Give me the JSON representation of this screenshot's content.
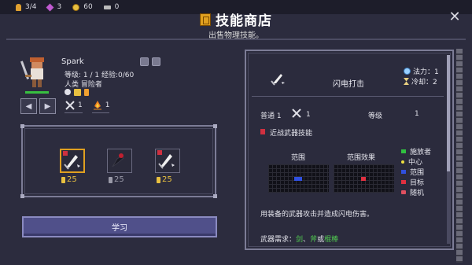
{
  "topbar": {
    "hp": "3/4",
    "gems": "3",
    "gold": "60",
    "keys": "0"
  },
  "header": {
    "title": "技能商店",
    "subtitle": "出售物理技能。",
    "close_icon": "close-icon"
  },
  "character": {
    "name": "Spark",
    "level_text": "等级: 1 / 1   经验:0/60",
    "class_text": "人类 冒险者",
    "hp_fraction": 1.0
  },
  "skill_points": [
    {
      "icon": "crossed-swords-icon",
      "value": "1"
    },
    {
      "icon": "campfire-icon",
      "value": "1"
    }
  ],
  "shop_skills": [
    {
      "icon": "lightning-strike-icon",
      "cost": "25",
      "selected": true
    },
    {
      "icon": "dark-slash-icon",
      "cost": "25",
      "selected": false
    },
    {
      "icon": "lightning-strike-icon",
      "cost": "25",
      "selected": false
    }
  ],
  "learn_button": "学习",
  "detail": {
    "skill_name": "闪电打击",
    "mana": "法力：1",
    "cooldown": "冷却：2",
    "normal_label": "普通 1",
    "normal_value": "1",
    "level_label": "等级",
    "level_value": "1",
    "melee_label": "近战武器技能",
    "range_label": "范围",
    "effect_label": "范围效果",
    "legend": [
      {
        "label": "施放者",
        "color": "#30c040"
      },
      {
        "label": "中心",
        "color": "#f0e040"
      },
      {
        "label": "范围",
        "color": "#3050e0"
      },
      {
        "label": "目标",
        "color": "#e03040"
      },
      {
        "label": "随机",
        "color": "#e05060"
      }
    ],
    "description": "用装备的武器攻击并造成闪电伤害。",
    "weapon_req_prefix": "武器需求：",
    "weapon_sword": "剑",
    "weapon_sep1": "、",
    "weapon_axe": "斧",
    "weapon_or": "或",
    "weapon_club": "棍棒"
  },
  "colors": {
    "accent": "#e0a020",
    "panel_border": "#7c7c96",
    "learn_button": "#50508a"
  }
}
